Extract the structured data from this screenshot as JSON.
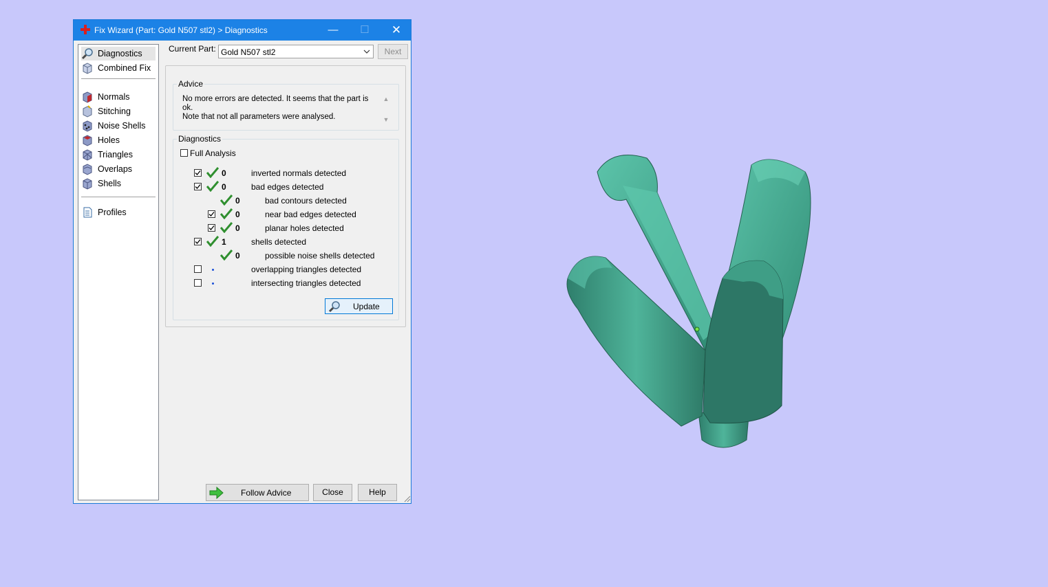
{
  "window": {
    "title": "Fix Wizard (Part: Gold N507 stl2) > Diagnostics",
    "min_icon": "minimize-icon",
    "max_icon": "maximize-icon",
    "close_icon": "close-icon"
  },
  "nav": {
    "items": [
      {
        "label": "Diagnostics",
        "icon": "magnifier-icon",
        "selected": true
      },
      {
        "label": "Combined Fix",
        "icon": "combined-fix-icon"
      },
      {
        "label": "Normals",
        "icon": "normals-icon"
      },
      {
        "label": "Stitching",
        "icon": "stitching-icon"
      },
      {
        "label": "Noise Shells",
        "icon": "noise-shells-icon"
      },
      {
        "label": "Holes",
        "icon": "holes-icon"
      },
      {
        "label": "Triangles",
        "icon": "triangles-icon"
      },
      {
        "label": "Overlaps",
        "icon": "overlaps-icon"
      },
      {
        "label": "Shells",
        "icon": "shells-icon"
      },
      {
        "label": "Profiles",
        "icon": "profiles-icon"
      }
    ]
  },
  "current_part": {
    "label": "Current Part:",
    "value": "Gold N507 stl2",
    "next_label": "Next"
  },
  "advice": {
    "title": "Advice",
    "line1": "No more errors are detected. It seems that the part is ok.",
    "line2": "Note that not all parameters were analysed."
  },
  "diagnostics": {
    "title": "Diagnostics",
    "full_analysis_label": "Full Analysis",
    "full_analysis_checked": false,
    "rows": [
      {
        "checkbox": true,
        "checked": true,
        "status": "ok",
        "count": "0",
        "label": "inverted normals detected"
      },
      {
        "checkbox": true,
        "checked": true,
        "status": "ok",
        "count": "0",
        "label": "bad edges detected"
      },
      {
        "checkbox": false,
        "checked": false,
        "status": "ok",
        "count": "0",
        "label": "bad contours detected"
      },
      {
        "checkbox": true,
        "checked": true,
        "status": "ok",
        "count": "0",
        "label": "near bad edges detected"
      },
      {
        "checkbox": true,
        "checked": true,
        "status": "ok",
        "count": "0",
        "label": "planar holes detected"
      },
      {
        "checkbox": true,
        "checked": true,
        "status": "ok",
        "count": "1",
        "label": "shells detected"
      },
      {
        "checkbox": false,
        "checked": false,
        "status": "ok",
        "count": "0",
        "label": "possible noise shells detected"
      },
      {
        "checkbox": true,
        "checked": false,
        "status": "pending",
        "count": "",
        "label": "overlapping triangles detected"
      },
      {
        "checkbox": true,
        "checked": false,
        "status": "pending",
        "count": "",
        "label": "intersecting triangles detected"
      }
    ],
    "update_label": "Update"
  },
  "footer": {
    "follow_advice_label": "Follow Advice",
    "close_label": "Close",
    "help_label": "Help"
  },
  "colors": {
    "background": "#c8c8fb",
    "titlebar": "#1c82e6",
    "model": "#3f9e86",
    "tick": "#2f8f2f"
  }
}
